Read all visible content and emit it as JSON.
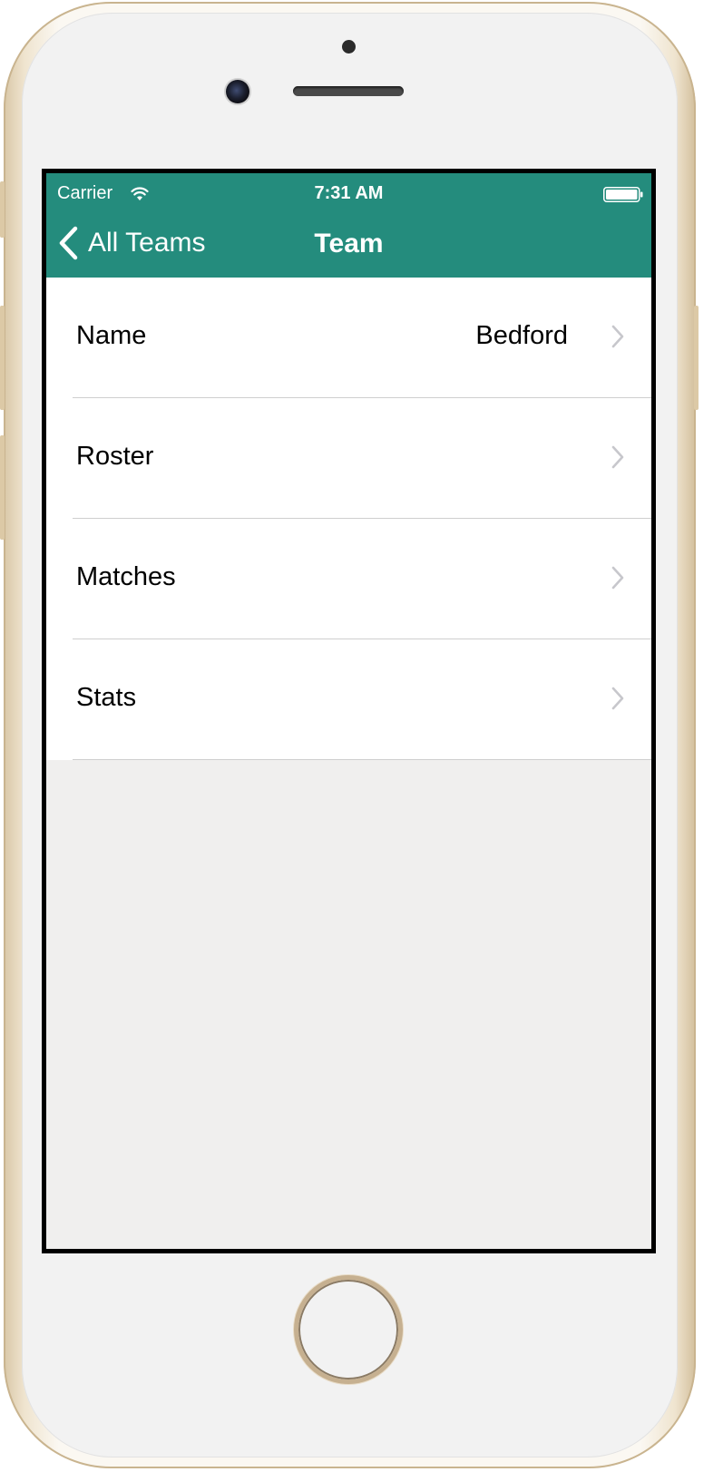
{
  "status_bar": {
    "carrier": "Carrier",
    "time": "7:31 AM",
    "wifi_icon": "wifi-icon",
    "battery_icon": "battery-icon"
  },
  "nav_bar": {
    "back_label": "All Teams",
    "back_icon": "chevron-left-icon",
    "title": "Team",
    "background_color": "#248c7d"
  },
  "table": {
    "rows": [
      {
        "label": "Name",
        "value": "Bedford",
        "accessory": "chevron-right-icon"
      },
      {
        "label": "Roster",
        "value": "",
        "accessory": "chevron-right-icon"
      },
      {
        "label": "Matches",
        "value": "",
        "accessory": "chevron-right-icon"
      },
      {
        "label": "Stats",
        "value": "",
        "accessory": "chevron-right-icon"
      }
    ]
  },
  "colors": {
    "accent": "#248c7d",
    "background": "#f0efee",
    "separator": "#cfcfcf",
    "disclosure": "#c7c7cc"
  }
}
